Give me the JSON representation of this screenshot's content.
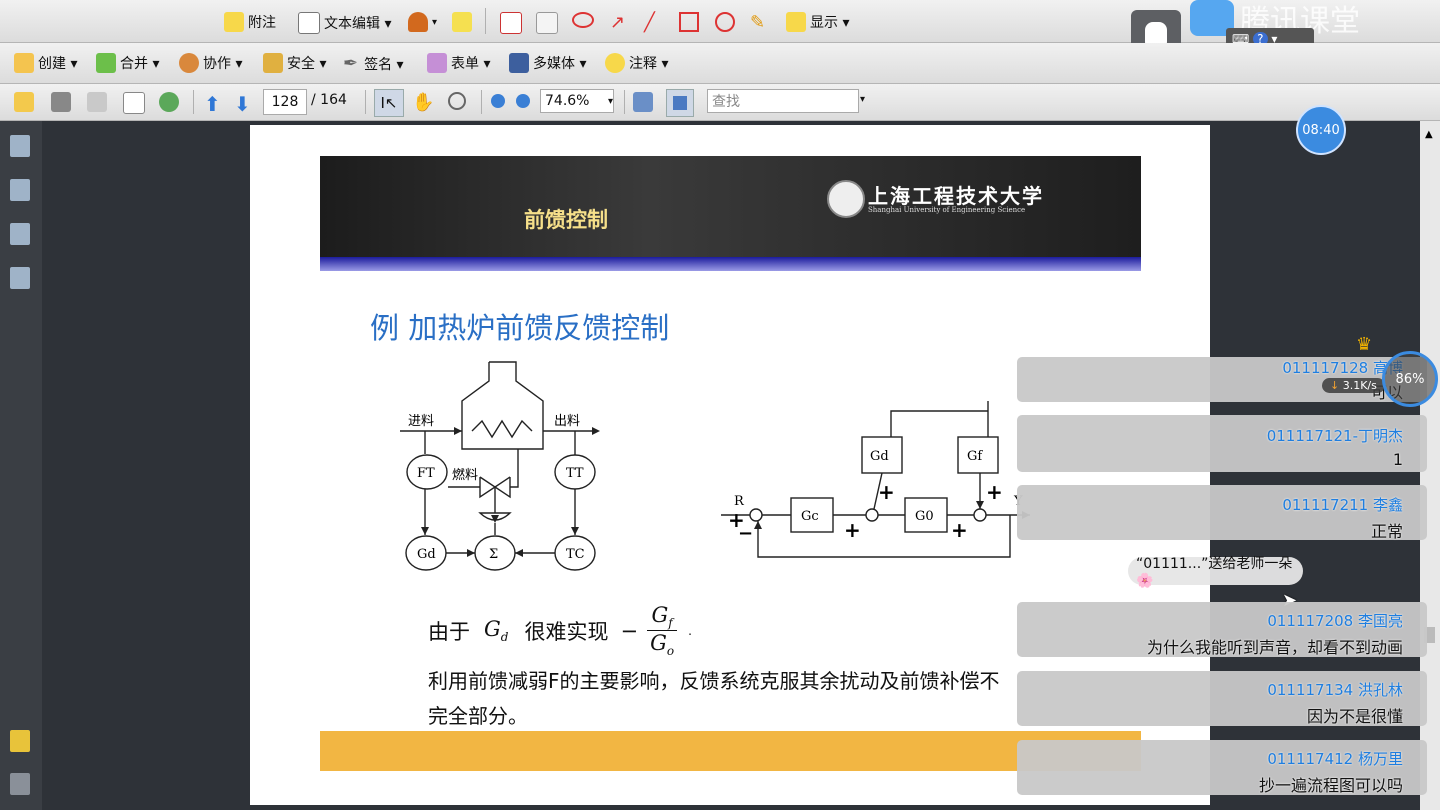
{
  "toolbar1": {
    "comment": "附注",
    "text_edit": "文本编辑 ▾",
    "display": "显示 ▾"
  },
  "toolbar2": {
    "create": "创建 ▾",
    "merge": "合并 ▾",
    "collaborate": "协作 ▾",
    "security": "安全 ▾",
    "sign": "签名 ▾",
    "forms": "表单 ▾",
    "multimedia": "多媒体 ▾",
    "comments": "注释 ▾"
  },
  "toolbar3": {
    "page_current": "128",
    "page_total": "/ 164",
    "zoom": "74.6%",
    "search_placeholder": "查找"
  },
  "tencent": {
    "brand": "腾讯课堂",
    "net_speed": "3.1K/s",
    "percent": "86%"
  },
  "clock": "08:40",
  "slide": {
    "banner_title": "前馈控制",
    "logo_cn": "上海工程技术大学",
    "logo_en": "Shanghai University of Engineering Science",
    "example_title": "例  加热炉前馈反馈控制",
    "diagram": {
      "feed_in": "进料",
      "feed_out": "出料",
      "fuel": "燃料",
      "ft": "FT",
      "tt": "TT",
      "gd_left": "Gd",
      "sigma": "Σ",
      "tc": "TC",
      "gd_block": "Gd",
      "gf_block": "Gf",
      "gc_block": "Gc",
      "g0_block": "G0",
      "r": "R",
      "y": "Y"
    },
    "formula_prefix": "由于",
    "formula_gd": "G",
    "formula_gd_sub": "d",
    "formula_mid": "很难实现",
    "frac_num": "G",
    "frac_num_sub": "f",
    "frac_den": "G",
    "frac_den_sub": "o",
    "line1": "利用前馈减弱F的主要影响，反馈系统克服其余扰动及前馈补偿不",
    "line2": "完全部分。"
  },
  "chat": [
    {
      "name": "011117128 高博",
      "msg": "可以"
    },
    {
      "name": "011117121-丁明杰",
      "msg": "1"
    },
    {
      "name": "011117211 李鑫",
      "msg": "正常"
    },
    {
      "name": "011117208 李国亮",
      "msg": "为什么我能听到声音，却看不到动画"
    },
    {
      "name": "011117134 洪孔林",
      "msg": "因为不是很懂"
    },
    {
      "name": "011117412 杨万里",
      "msg": "抄一遍流程图可以吗"
    }
  ],
  "gift_text": "“01111...”送给老师一朵🌸",
  "colors": {
    "slide_title_blue": "#2a6fc5",
    "banner_title_yellow": "#f6e08a",
    "chat_name_blue": "#1e7ee0",
    "orange_bar": "#f2b643"
  }
}
